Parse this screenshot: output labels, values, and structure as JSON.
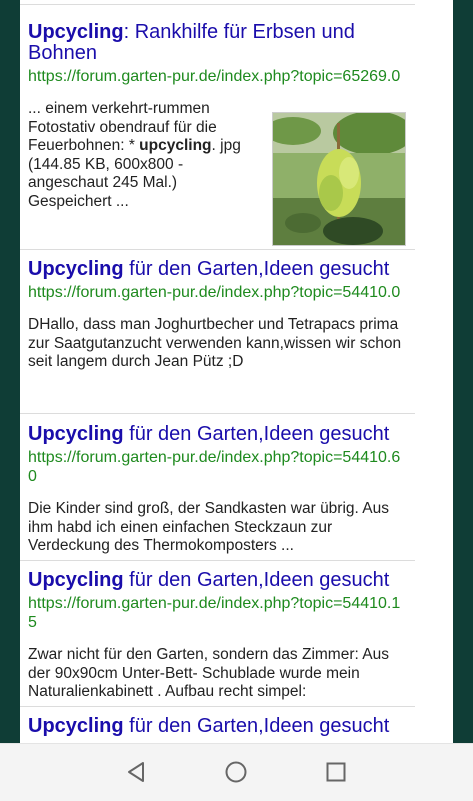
{
  "results": [
    {
      "title_bold": "Upcycling",
      "title_rest": ": Rankhilfe für Erbsen und Bohnen",
      "url": "https://forum.garten-pur.de/index.php?topic=65269.0",
      "snippet_pre": "... einem verkehrt-rummen Fotostativ obendrauf für die Feuerbohnen: * ",
      "snippet_bold": "upcycling",
      "snippet_post": ". jpg (144.85 KB, 600x800 - angeschaut 245 Mal.) Gespeichert ...",
      "thumbnail": "garden-plant-photo"
    },
    {
      "title_bold": "Upcycling",
      "title_rest": " für den Garten,Ideen gesucht",
      "url": "https://forum.garten-pur.de/index.php?topic=54410.0",
      "snippet": "DHallo, dass man Joghurtbecher und Tetrapacs prima zur Saatgutanzucht verwenden kann,wissen wir schon seit langem durch Jean Pütz ;D"
    },
    {
      "title_bold": "Upcycling",
      "title_rest": " für den Garten,Ideen gesucht",
      "url": "https://forum.garten-pur.de/index.php?topic=54410.60",
      "snippet": "Die Kinder sind groß, der Sandkasten war übrig. Aus ihm habd ich einen einfachen Steckzaun zur Verdeckung des Thermokomposters ..."
    },
    {
      "title_bold": "Upcycling",
      "title_rest": " für den Garten,Ideen gesucht",
      "url": "https://forum.garten-pur.de/index.php?topic=54410.15",
      "snippet": "Zwar nicht für den Garten, sondern das Zimmer: Aus der 90x90cm Unter-Bett- Schublade wurde mein Naturalienkabinett . Aufbau recht simpel:"
    },
    {
      "title_bold": "Upcycling",
      "title_rest": " für den Garten,Ideen gesucht"
    }
  ],
  "navbar": {
    "back_icon": "back-triangle-icon",
    "home_icon": "home-circle-icon",
    "recents_icon": "recents-square-icon"
  }
}
